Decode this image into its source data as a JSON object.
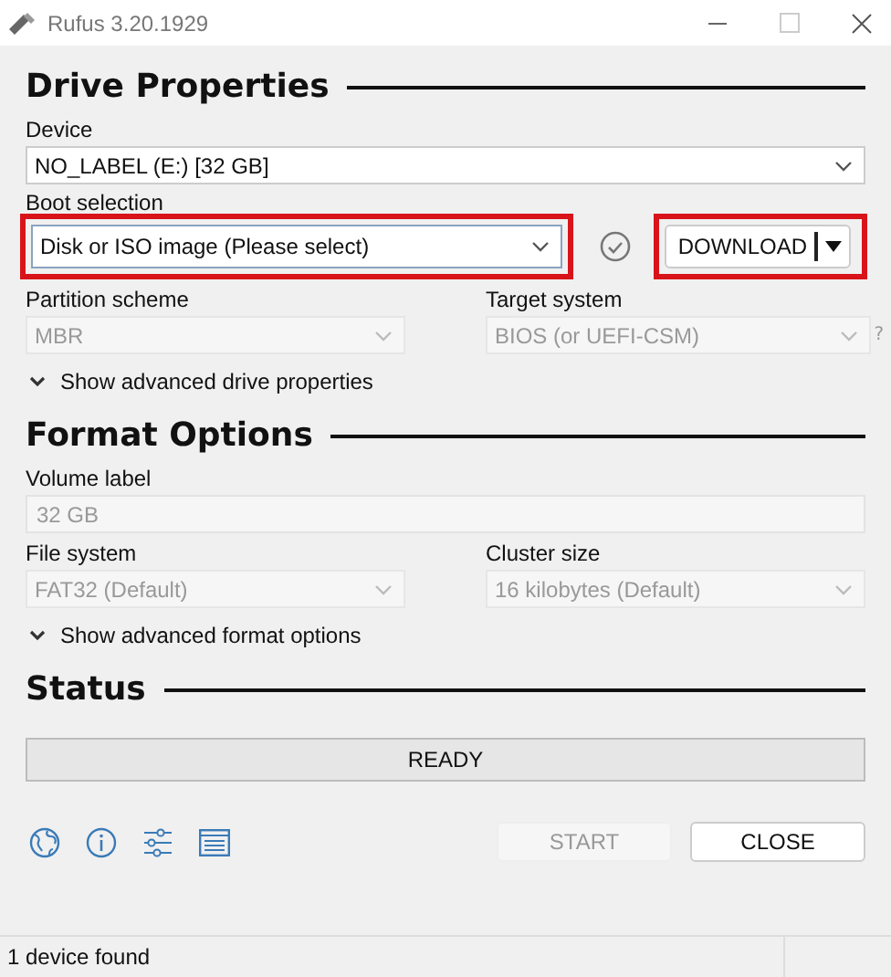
{
  "window": {
    "title": "Rufus 3.20.1929"
  },
  "sections": [
    {
      "heading": "Drive Properties"
    },
    {
      "heading": "Format Options"
    },
    {
      "heading": "Status"
    }
  ],
  "device": {
    "label": "Device",
    "value": "NO_LABEL (E:) [32 GB]",
    "disabled": false
  },
  "boot_selection": {
    "label": "Boot selection",
    "value": "Disk or ISO image (Please select)",
    "highlighted": true
  },
  "download_button": {
    "label": "DOWNLOAD",
    "highlighted": true
  },
  "partition_scheme": {
    "label": "Partition scheme",
    "value": "MBR",
    "disabled": true
  },
  "target_system": {
    "label": "Target system",
    "value": "BIOS (or UEFI-CSM)",
    "disabled": true,
    "help": "?"
  },
  "advanced_drive": {
    "label": "Show advanced drive properties",
    "expanded": false
  },
  "volume_label": {
    "label": "Volume label",
    "value": "32 GB",
    "disabled": true
  },
  "file_system": {
    "label": "File system",
    "value": "FAT32 (Default)",
    "disabled": true
  },
  "cluster_size": {
    "label": "Cluster size",
    "value": "16 kilobytes (Default)",
    "disabled": true
  },
  "advanced_format": {
    "label": "Show advanced format options",
    "expanded": false
  },
  "status": {
    "text": "READY"
  },
  "buttons": [
    {
      "label": "START",
      "disabled": true
    },
    {
      "label": "CLOSE",
      "disabled": false
    }
  ],
  "status_bar": {
    "text": "1 device found"
  }
}
